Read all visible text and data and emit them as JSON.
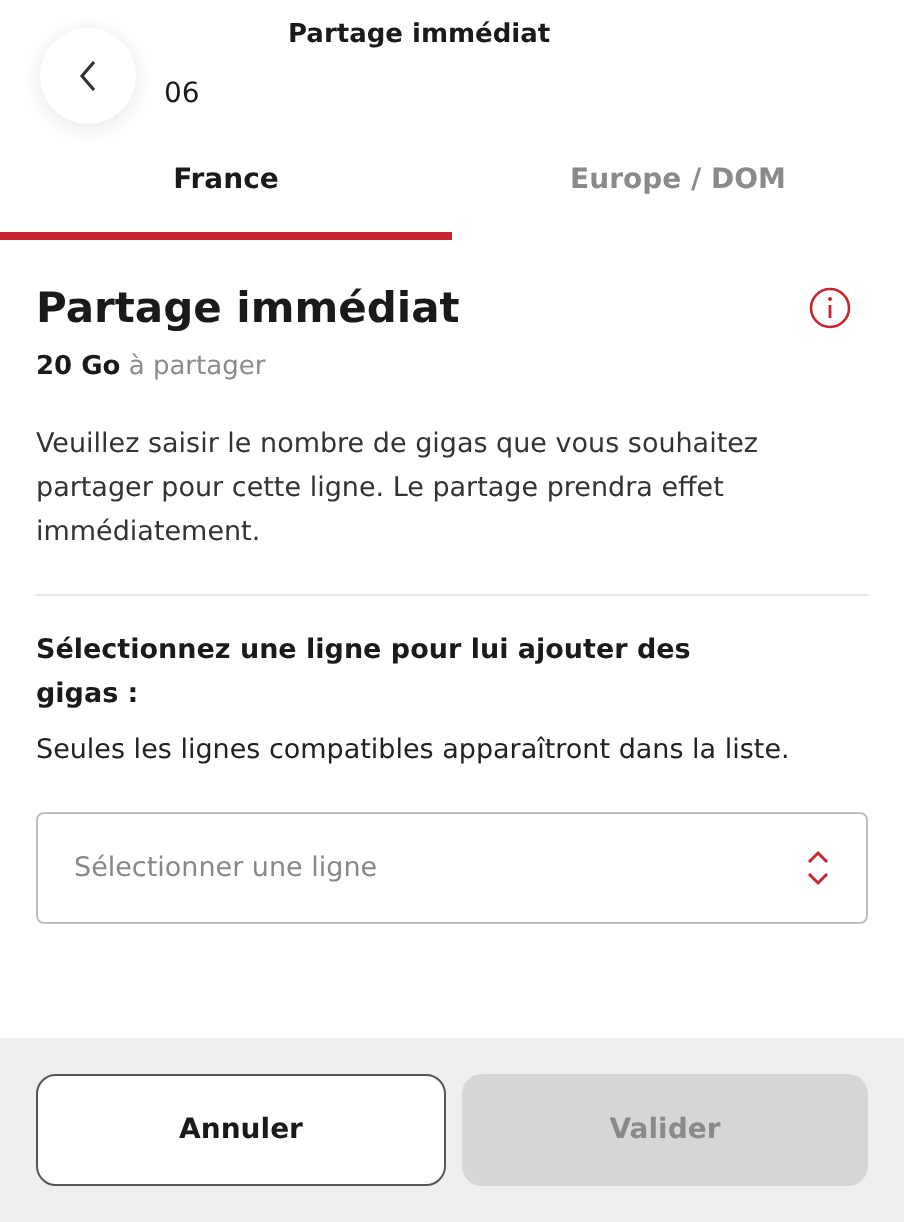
{
  "header": {
    "title": "Partage immédiat",
    "subtitle": "06"
  },
  "tabs": [
    {
      "label": "France",
      "selected": true
    },
    {
      "label": "Europe / DOM",
      "selected": false
    }
  ],
  "section": {
    "title": "Partage immédiat",
    "amount": "20 Go",
    "amount_suffix": "à partager",
    "description": "Veuillez saisir le nombre de gigas que vous souhaitez partager pour cette ligne. Le partage prendra effet immédiatement."
  },
  "line_select": {
    "heading": "Sélectionnez une ligne pour lui ajouter des gigas :",
    "hint": "Seules les lignes compatibles apparaîtront dans la liste.",
    "placeholder": "Sélectionner une ligne"
  },
  "buttons": [
    {
      "label": "Annuler",
      "kind": "secondary",
      "disabled": false
    },
    {
      "label": "Valider",
      "kind": "primary",
      "disabled": true
    }
  ]
}
